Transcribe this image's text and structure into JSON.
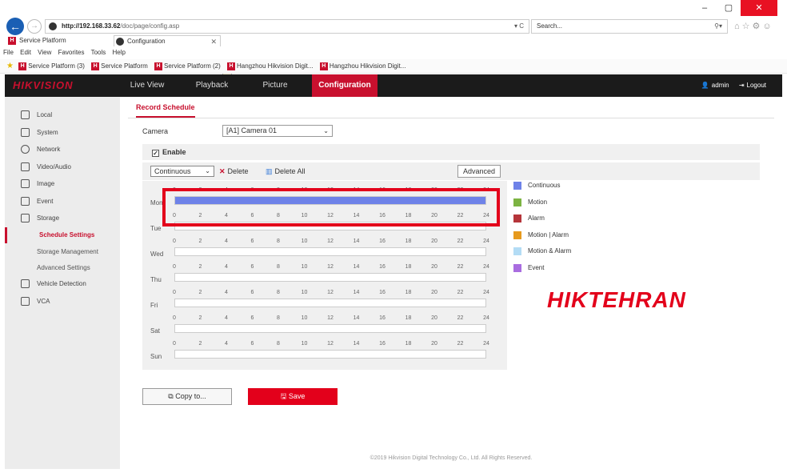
{
  "browser": {
    "url_host": "http://192.168.33.62",
    "url_path": "/doc/page/config.asp",
    "url_controls": "▾ C",
    "search_placeholder": "Search...",
    "tabs": [
      {
        "label": "Service Platform"
      },
      {
        "label": "Configuration"
      }
    ],
    "menu": [
      "File",
      "Edit",
      "View",
      "Favorites",
      "Tools",
      "Help"
    ],
    "favorites": [
      "Service Platform (3)",
      "Service Platform",
      "Service Platform (2)",
      "Hangzhou Hikvision Digit...",
      "Hangzhou Hikvision Digit..."
    ]
  },
  "app": {
    "logo": "HIKVISION",
    "nav": [
      "Live View",
      "Playback",
      "Picture",
      "Configuration"
    ],
    "active_nav": "Configuration",
    "user": "admin",
    "logout": "Logout"
  },
  "sidebar": {
    "items": [
      {
        "label": "Local",
        "icon": "monitor-icon"
      },
      {
        "label": "System",
        "icon": "system-icon"
      },
      {
        "label": "Network",
        "icon": "network-icon"
      },
      {
        "label": "Video/Audio",
        "icon": "video-audio-icon"
      },
      {
        "label": "Image",
        "icon": "image-icon"
      },
      {
        "label": "Event",
        "icon": "event-icon"
      },
      {
        "label": "Storage",
        "icon": "storage-icon"
      },
      {
        "label": "Schedule Settings"
      },
      {
        "label": "Storage Management"
      },
      {
        "label": "Advanced Settings"
      },
      {
        "label": "Vehicle Detection",
        "icon": "vehicle-icon"
      },
      {
        "label": "VCA",
        "icon": "vca-icon"
      }
    ],
    "active": "Schedule Settings"
  },
  "main": {
    "page_tab": "Record Schedule",
    "camera_label": "Camera",
    "camera_value": "[A1] Camera 01",
    "enable_label": "Enable",
    "enable_checked": true,
    "mode_value": "Continuous",
    "delete_label": "Delete",
    "delete_all_label": "Delete All",
    "advanced_label": "Advanced",
    "ticks": [
      "0",
      "2",
      "4",
      "6",
      "8",
      "10",
      "12",
      "14",
      "16",
      "18",
      "20",
      "22",
      "24"
    ],
    "days": [
      {
        "label": "Mon",
        "schedule": [
          {
            "start": 0,
            "end": 24,
            "type": "Continuous"
          }
        ]
      },
      {
        "label": "Tue",
        "schedule": []
      },
      {
        "label": "Wed",
        "schedule": []
      },
      {
        "label": "Thu",
        "schedule": []
      },
      {
        "label": "Fri",
        "schedule": []
      },
      {
        "label": "Sat",
        "schedule": []
      },
      {
        "label": "Sun",
        "schedule": []
      }
    ],
    "legend": [
      {
        "label": "Continuous",
        "color": "#6e82e8"
      },
      {
        "label": "Motion",
        "color": "#7cb342"
      },
      {
        "label": "Alarm",
        "color": "#b5353a"
      },
      {
        "label": "Motion | Alarm",
        "color": "#e69a1e"
      },
      {
        "label": "Motion & Alarm",
        "color": "#b3dcf5"
      },
      {
        "label": "Event",
        "color": "#a96de0"
      }
    ],
    "copy_label": "Copy to...",
    "save_label": "Save",
    "footer": "©2019 Hikvision Digital Technology Co., Ltd. All Rights Reserved."
  },
  "watermark": "HIKTEHRAN"
}
